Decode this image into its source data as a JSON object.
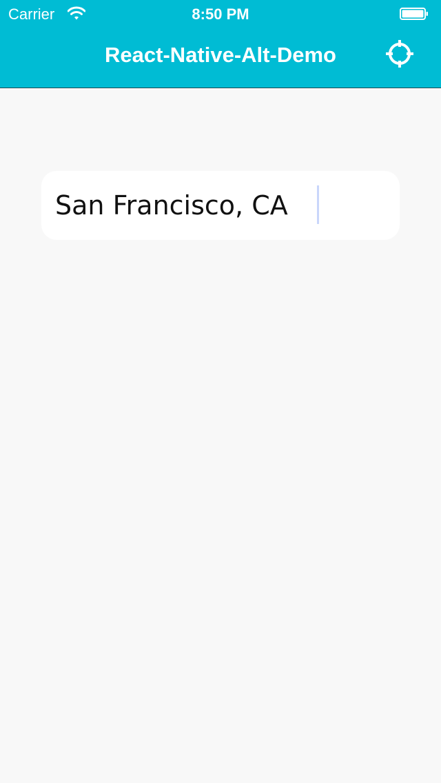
{
  "status_bar": {
    "carrier": "Carrier",
    "time": "8:50 PM",
    "wifi_icon": "wifi-icon",
    "battery_icon": "battery-icon"
  },
  "header": {
    "title": "React-Native-Alt-Demo",
    "locate_icon": "crosshair-icon",
    "background_color": "#00bcd4",
    "text_color": "#ffffff"
  },
  "search": {
    "value": "San Francisco, CA",
    "caret_color": "#c9d6fb"
  },
  "page": {
    "background_color": "#f8f8f8"
  }
}
